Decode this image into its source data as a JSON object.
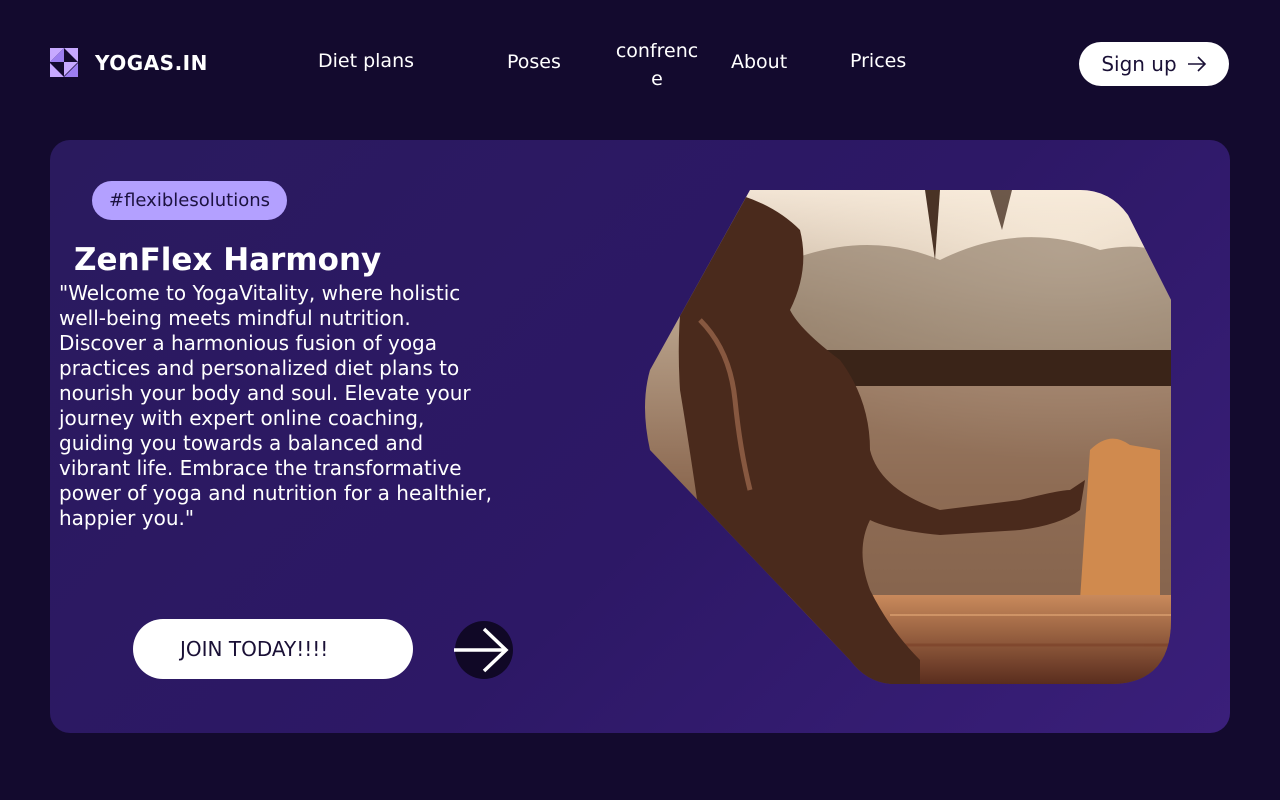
{
  "header": {
    "brand": "YOGAS.IN",
    "nav": [
      "Diet plans",
      "Poses",
      "confrence",
      "About",
      "Prices"
    ],
    "signup_label": "Sign up"
  },
  "hero": {
    "tag": "#flexiblesolutions",
    "title": "ZenFlex Harmony",
    "description": "\"Welcome to YogaVitality, where holistic well-being meets mindful nutrition. Discover a harmonious fusion of yoga practices and personalized diet plans to nourish your body and soul. Elevate your journey with expert online coaching, guiding you towards a balanced and vibrant life. Embrace the transformative power of yoga and nutrition for a healthier, happier you.\"",
    "cta_label": "JOIN TODAY!!!!"
  },
  "icons": {
    "logo": "brand-logo-icon",
    "signup": "arrow-right-icon",
    "next": "arrow-right-icon"
  },
  "colors": {
    "background": "#130a2e",
    "hero": "#2d1866",
    "tag": "#b3a0ff",
    "button": "#ffffff"
  }
}
